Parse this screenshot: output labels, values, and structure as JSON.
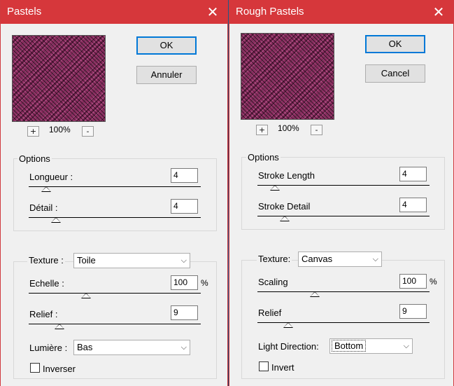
{
  "left_dialog": {
    "title": "Pastels",
    "ok_label": "OK",
    "cancel_label": "Annuler",
    "zoom_in": "+",
    "zoom_out": "-",
    "zoom_level": "100%",
    "options_label": "Options",
    "stroke_length_label": "Longueur :",
    "stroke_length_value": "4",
    "stroke_detail_label": "Détail :",
    "stroke_detail_value": "4",
    "texture_label": "Texture :",
    "texture_value": "Toile",
    "scaling_label": "Echelle :",
    "scaling_value": "100",
    "scaling_unit": "%",
    "relief_label": "Relief :",
    "relief_value": "9",
    "light_label": "Lumière :",
    "light_value": "Bas",
    "invert_label": "Inverser",
    "invert_checked": false
  },
  "right_dialog": {
    "title": "Rough Pastels",
    "ok_label": "OK",
    "cancel_label": "Cancel",
    "zoom_in": "+",
    "zoom_out": "-",
    "zoom_level": "100%",
    "options_label": "Options",
    "stroke_length_label": "Stroke Length",
    "stroke_length_value": "4",
    "stroke_detail_label": "Stroke Detail",
    "stroke_detail_value": "4",
    "texture_label": "Texture:",
    "texture_value": "Canvas",
    "scaling_label": "Scaling",
    "scaling_value": "100",
    "scaling_unit": "%",
    "relief_label": "Relief",
    "relief_value": "9",
    "light_label": "Light Direction:",
    "light_value": "Bottom",
    "invert_label": "Invert",
    "invert_checked": false
  },
  "icons": {
    "close": "close-icon",
    "dropdown": "chevron-down-icon"
  },
  "colors": {
    "titlebar": "#d6373b",
    "preview": "#8e2f63",
    "default_button_border": "#0078d7"
  }
}
